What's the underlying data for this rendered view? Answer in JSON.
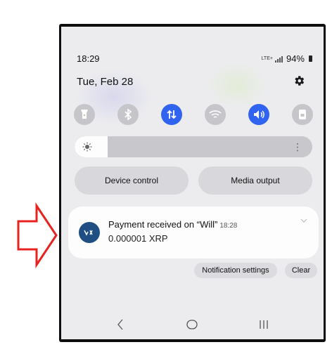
{
  "status_bar": {
    "time": "18:29",
    "network": "LTE+",
    "battery": "94%"
  },
  "header": {
    "date": "Tue, Feb 28"
  },
  "quick_toggles": [
    {
      "icon": "flashlight-icon",
      "state": "off"
    },
    {
      "icon": "bluetooth-icon",
      "state": "off"
    },
    {
      "icon": "mobile-data-icon",
      "state": "on"
    },
    {
      "icon": "wifi-icon",
      "state": "off"
    },
    {
      "icon": "sound-icon",
      "state": "on"
    },
    {
      "icon": "screen-lock-icon",
      "state": "off"
    }
  ],
  "brightness": {
    "level": 0.14
  },
  "buttons": {
    "device_control": "Device control",
    "media_output": "Media output"
  },
  "notification": {
    "title": "Payment received on “Will”",
    "time": "18:28",
    "body": "0.000001 XRP",
    "app_icon": "xrp-wallet-icon"
  },
  "actions": {
    "notification_settings": "Notification settings",
    "clear": "Clear"
  },
  "navigation": [
    "back-icon",
    "home-icon",
    "recents-icon"
  ],
  "colors": {
    "accent": "#2f63f0",
    "toggle_off": "#c6c6ca",
    "annotation_arrow": "#e8221f"
  }
}
